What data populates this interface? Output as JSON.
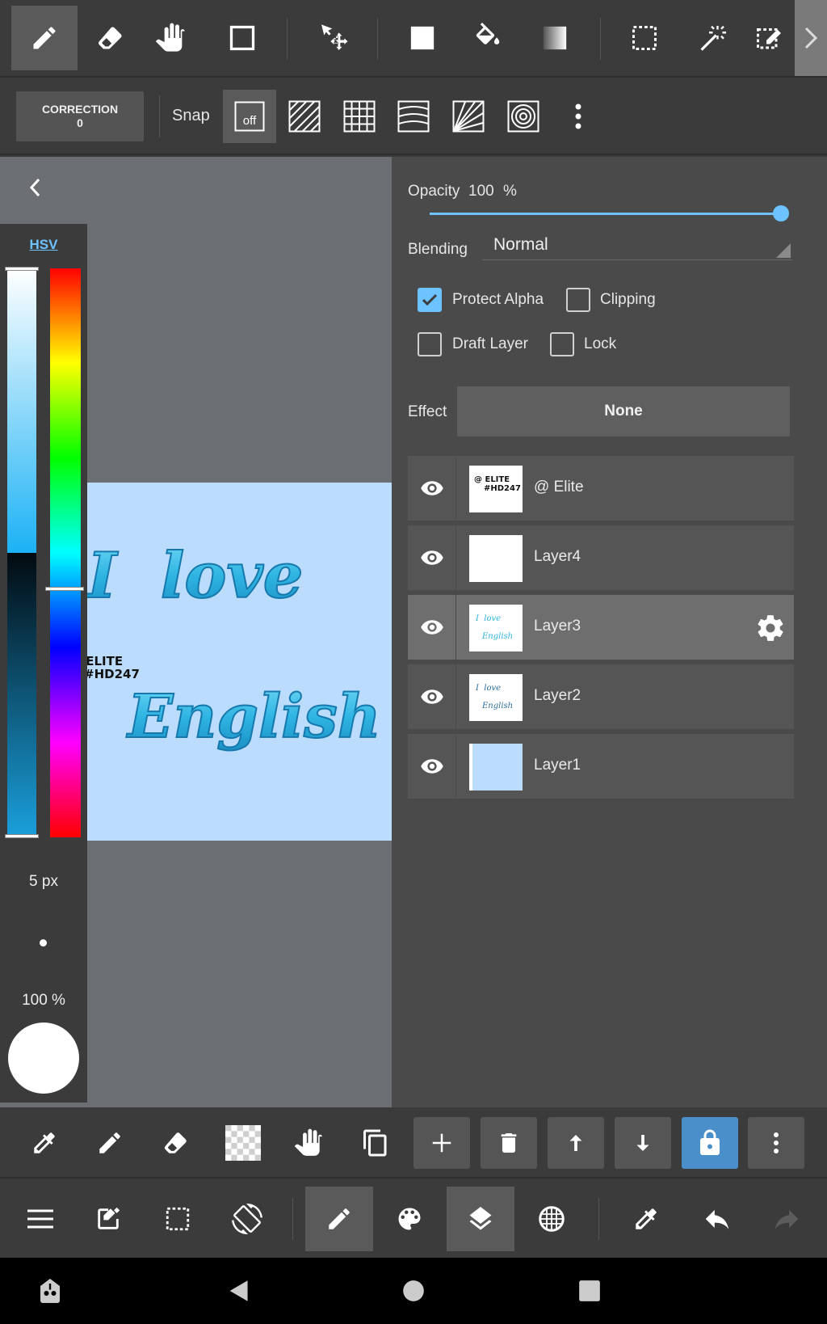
{
  "toolbar": {
    "tools": [
      {
        "name": "pen-tool",
        "icon": "pencil-icon",
        "active": true
      },
      {
        "name": "eraser-tool",
        "icon": "eraser-icon"
      },
      {
        "name": "hand-tool",
        "icon": "hand-icon"
      },
      {
        "name": "shape-tool",
        "icon": "square-outline-icon"
      },
      {
        "name": "move-tool",
        "icon": "move-arrow-icon"
      },
      {
        "name": "fill-tool",
        "icon": "filled-square-icon"
      },
      {
        "name": "bucket-tool",
        "icon": "paint-bucket-icon"
      },
      {
        "name": "gradient-tool",
        "icon": "gradient-icon"
      },
      {
        "name": "select-tool",
        "icon": "dashed-rect-icon"
      },
      {
        "name": "magic-wand-tool",
        "icon": "magic-wand-icon"
      },
      {
        "name": "select-pen-tool",
        "icon": "select-pen-icon"
      }
    ]
  },
  "toolbar2": {
    "correction_label": "CORRECTION",
    "correction_value": "0",
    "snap_label": "Snap",
    "snap_off_label": "off"
  },
  "color_panel": {
    "mode_tab": "HSV",
    "brush_size": "5 px",
    "brush_opacity": "100 %",
    "current_color": "#ffffff"
  },
  "artwork": {
    "line1": "I  love",
    "watermark_line1": "@ ELITE",
    "watermark_line2": "#HD247",
    "line2": "English",
    "background": "#bbdcfc"
  },
  "layer_props": {
    "opacity_label": "Opacity",
    "opacity_value": "100",
    "opacity_unit": "%",
    "opacity_fraction": 1.0,
    "blending_label": "Blending",
    "blending_value": "Normal",
    "protect_alpha_label": "Protect Alpha",
    "protect_alpha": true,
    "clipping_label": "Clipping",
    "clipping": false,
    "draft_layer_label": "Draft Layer",
    "draft_layer": false,
    "lock_label": "Lock",
    "lock": false,
    "effect_label": "Effect",
    "effect_value": "None"
  },
  "layers": [
    {
      "name": "@ Elite",
      "thumb_text1": "@ ELITE",
      "thumb_text2": "#HD247"
    },
    {
      "name": "Layer4"
    },
    {
      "name": "Layer3",
      "selected": true,
      "thumb_text1": "I  love",
      "thumb_text2": "English"
    },
    {
      "name": "Layer2",
      "thumb_text1": "I  love",
      "thumb_text2": "English"
    },
    {
      "name": "Layer1"
    }
  ],
  "colors": {
    "accent": "#6cc3ff",
    "lock_active": "#4a8fc9"
  }
}
